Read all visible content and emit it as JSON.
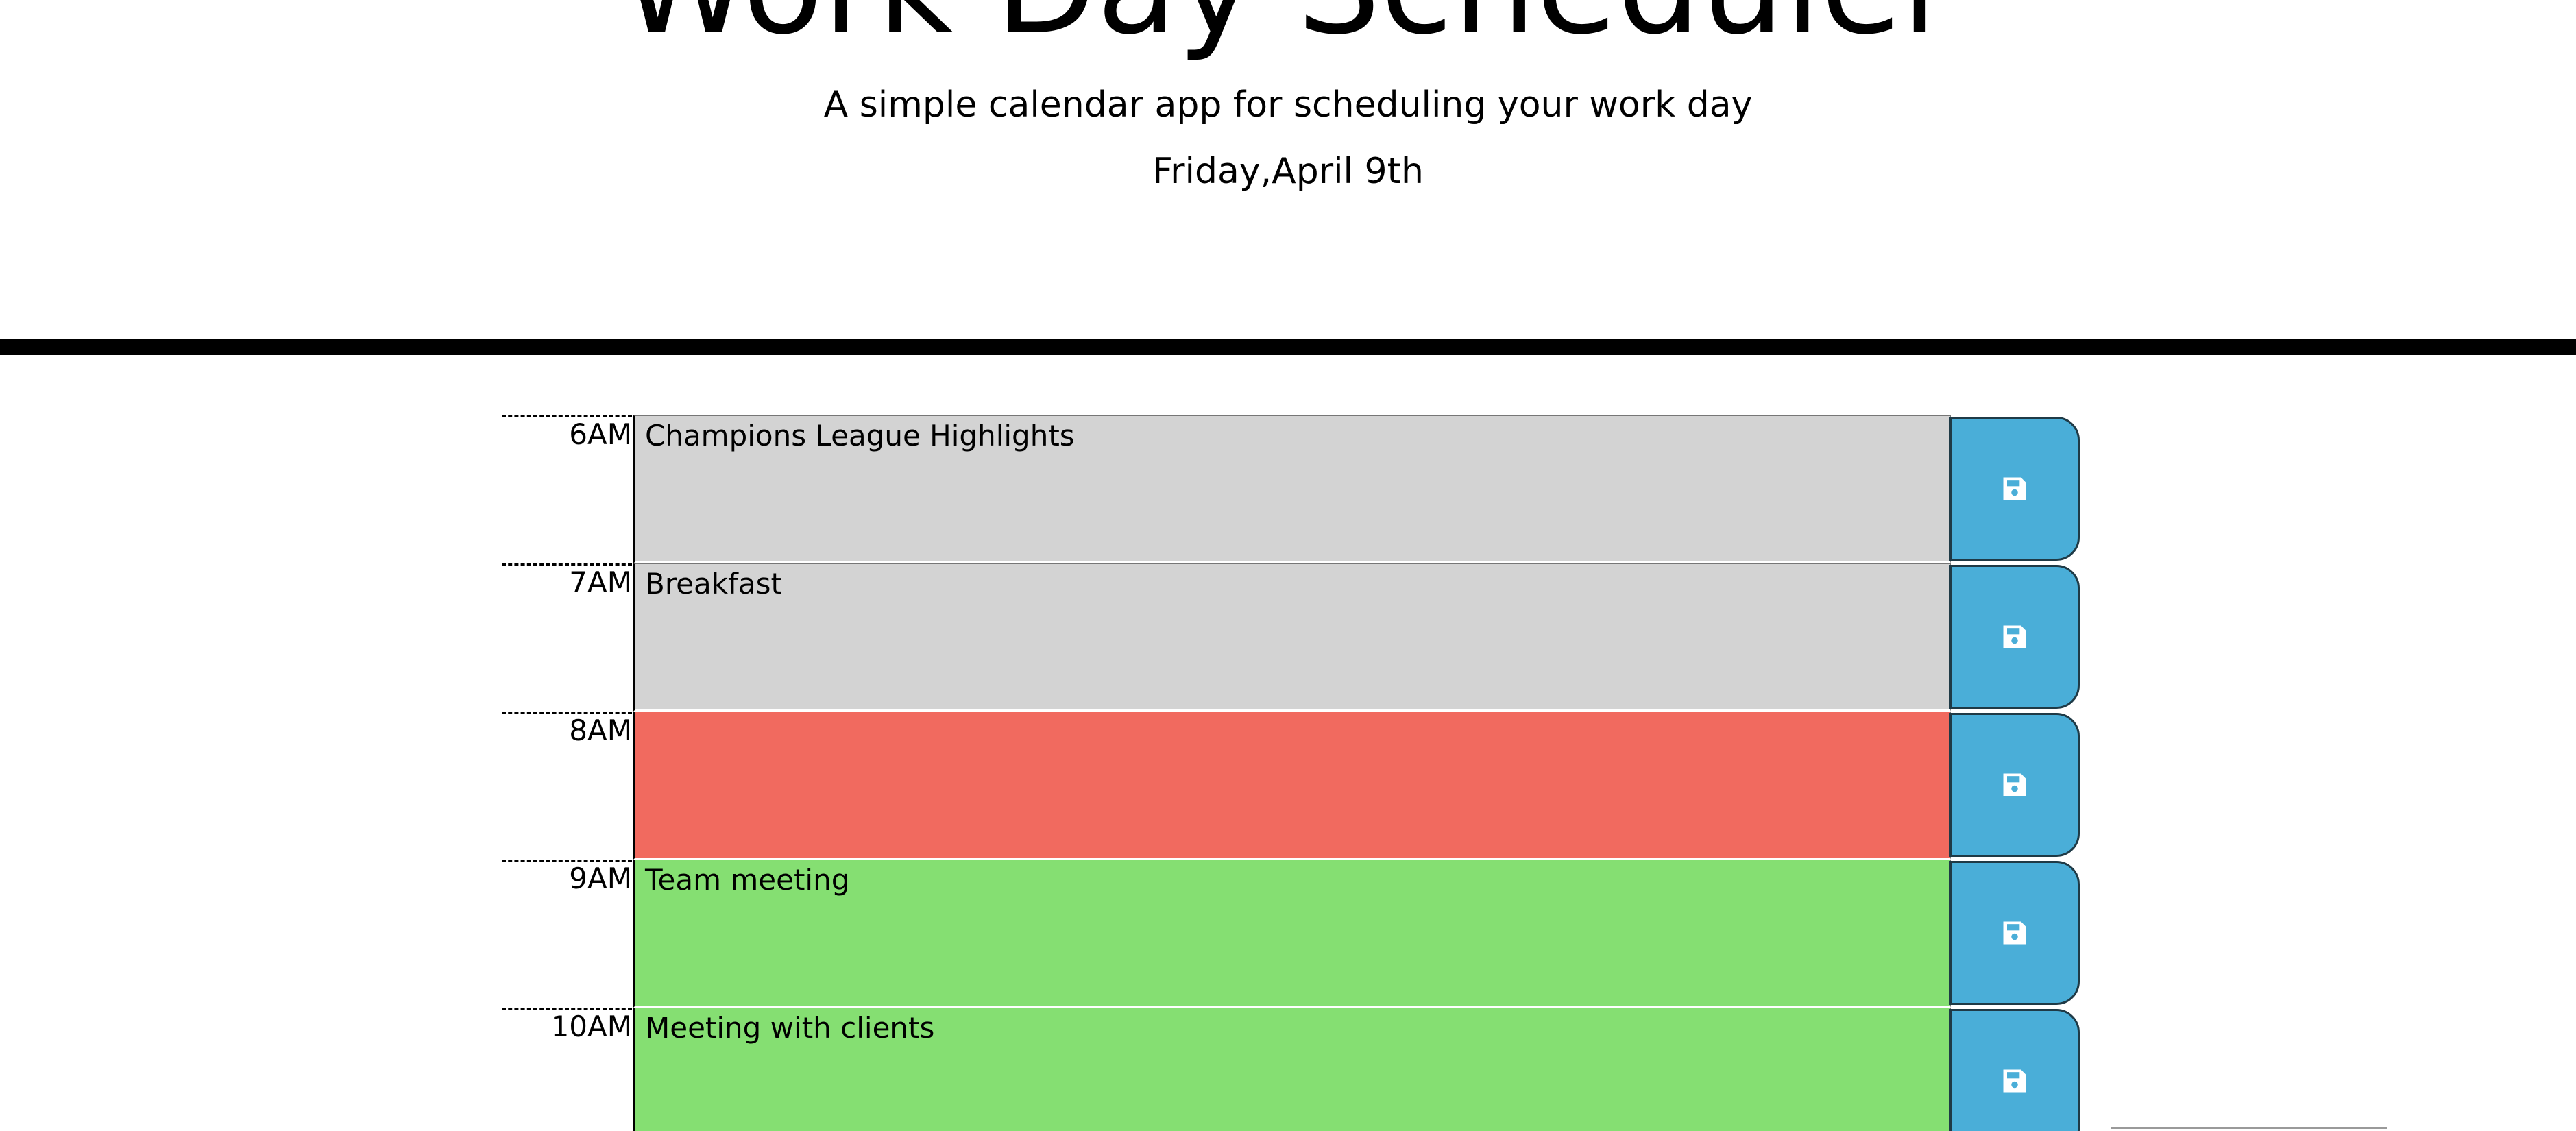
{
  "header": {
    "title": "Work Day Scheduler",
    "subtitle": "A simple calendar app for scheduling your work day",
    "current_day": "Friday,April 9th"
  },
  "colors": {
    "past": "#d3d3d3",
    "present": "#f16a5f",
    "future": "#85df72",
    "save_button": "#4aaed8"
  },
  "time_blocks": [
    {
      "hour": "6AM",
      "text": "Champions League Highlights",
      "state": "past",
      "save_icon": "save-icon"
    },
    {
      "hour": "7AM",
      "text": "Breakfast",
      "state": "past",
      "save_icon": "save-icon"
    },
    {
      "hour": "8AM",
      "text": "",
      "state": "present",
      "save_icon": "save-icon"
    },
    {
      "hour": "9AM",
      "text": "Team meeting",
      "state": "future",
      "save_icon": "save-icon"
    },
    {
      "hour": "10AM",
      "text": "Meeting with clients",
      "state": "future",
      "save_icon": "save-icon"
    }
  ]
}
